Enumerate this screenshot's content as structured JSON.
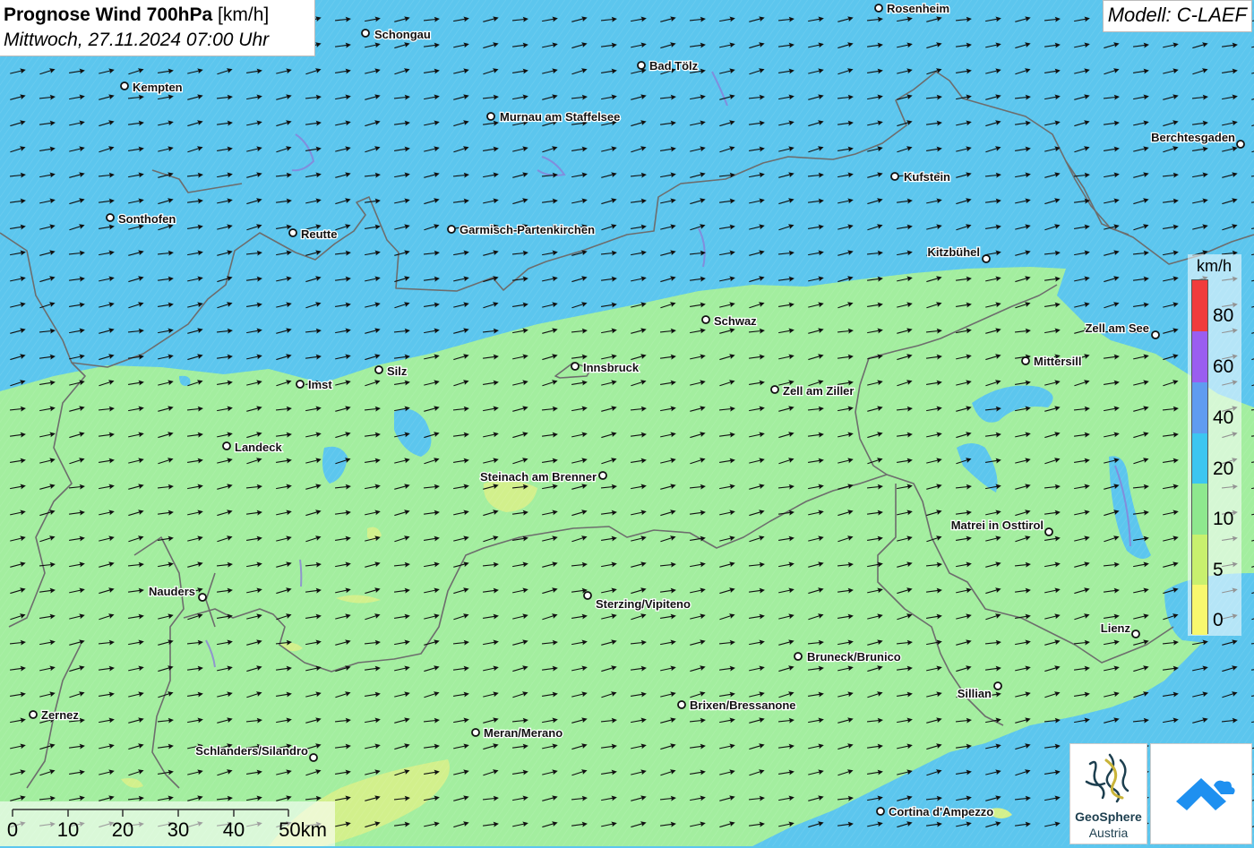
{
  "title": {
    "main": "Prognose Wind 700hPa",
    "unit": "[km/h]",
    "datetime": "Mittwoch, 27.11.2024 07:00 Uhr"
  },
  "model_label": "Modell: C-LAEF",
  "legend": {
    "unit": "km/h",
    "labels": [
      "80",
      "60",
      "40",
      "20",
      "10",
      "5",
      "0"
    ],
    "classes": [
      {
        "color": "#f03c3c"
      },
      {
        "color": "#9a5ef0"
      },
      {
        "color": "#5f9cf0"
      },
      {
        "color": "#3cc6f0"
      },
      {
        "color": "#8ee88e"
      },
      {
        "color": "#c8f06e"
      },
      {
        "color": "#f8f86e"
      }
    ]
  },
  "scale_bar": {
    "ticks": [
      "0",
      "10",
      "20",
      "30",
      "40",
      "50km"
    ]
  },
  "cities": [
    {
      "name": "Rosenheim"
    },
    {
      "name": "Schongau"
    },
    {
      "name": "Bad Tölz"
    },
    {
      "name": "Kempten"
    },
    {
      "name": "Murnau am Staffelsee"
    },
    {
      "name": "Berchtesgaden"
    },
    {
      "name": "Kufstein"
    },
    {
      "name": "Sonthofen"
    },
    {
      "name": "Reutte"
    },
    {
      "name": "Garmisch-Partenkirchen"
    },
    {
      "name": "Kitzbühel"
    },
    {
      "name": "Schwaz"
    },
    {
      "name": "Zell am See"
    },
    {
      "name": "Mittersill"
    },
    {
      "name": "Innsbruck"
    },
    {
      "name": "Silz"
    },
    {
      "name": "Imst"
    },
    {
      "name": "Zell am Ziller"
    },
    {
      "name": "Landeck"
    },
    {
      "name": "Steinach am Brenner"
    },
    {
      "name": "Matrei in Osttirol"
    },
    {
      "name": "Nauders"
    },
    {
      "name": "Sterzing/Vipiteno"
    },
    {
      "name": "Lienz"
    },
    {
      "name": "Bruneck/Brunico"
    },
    {
      "name": "Sillian"
    },
    {
      "name": "Brixen/Bressanone"
    },
    {
      "name": "Zernez"
    },
    {
      "name": "Meran/Merano"
    },
    {
      "name": "Schlanders/Silandro"
    },
    {
      "name": "Cortina d'Ampezzo"
    }
  ],
  "logos": {
    "geosphere_name": "GeoSphere",
    "geosphere_sub": "Austria",
    "app_icon": "app-logo-icon"
  },
  "colors": {
    "blue_zone": "#5cc6ee",
    "green_zone": "#a3ee9f",
    "yellowgreen_zone": "#d2f08c",
    "arrow": "#111111",
    "border": "#6d6d6d"
  }
}
